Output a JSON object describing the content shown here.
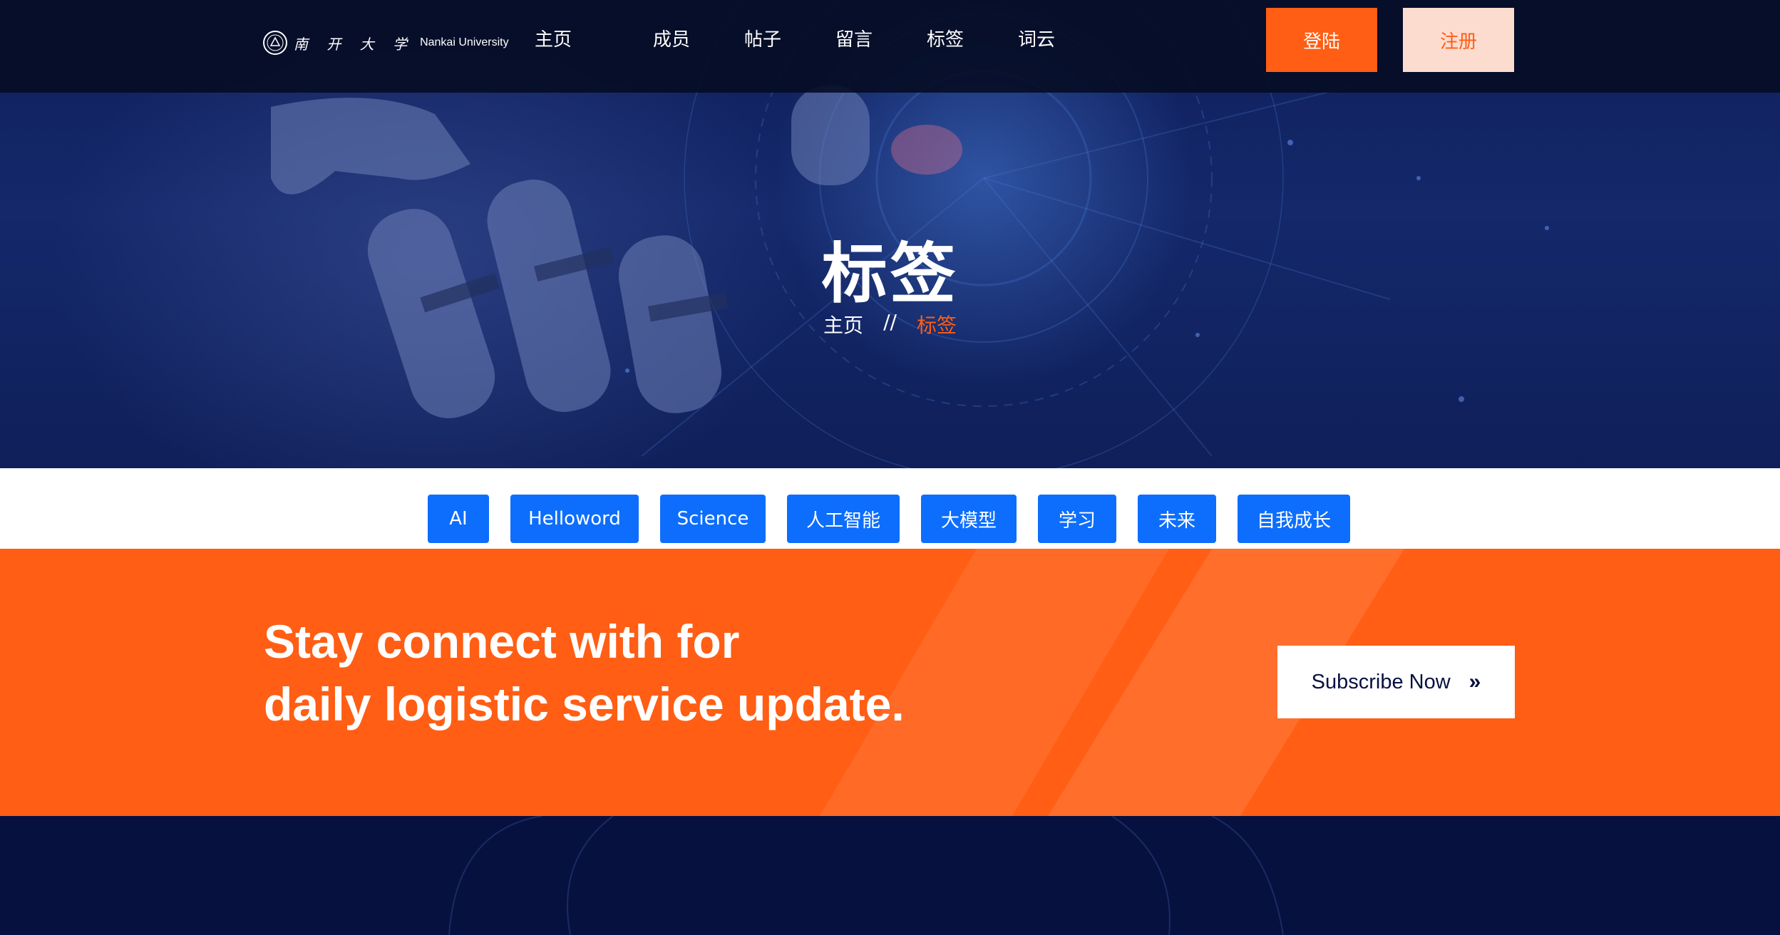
{
  "brand": {
    "name_cn": "南 开 大 学",
    "name_en": "Nankai University"
  },
  "nav": {
    "items": [
      {
        "label": "主页"
      },
      {
        "label": "成员"
      },
      {
        "label": "帖子"
      },
      {
        "label": "留言"
      },
      {
        "label": "标签"
      },
      {
        "label": "词云"
      }
    ],
    "login_label": "登陆",
    "register_label": "注册"
  },
  "hero": {
    "title": "标签",
    "breadcrumb": {
      "home": "主页",
      "separator": "//",
      "current": "标签"
    }
  },
  "tags": [
    {
      "label": "AI"
    },
    {
      "label": "Helloword"
    },
    {
      "label": "Science"
    },
    {
      "label": "人工智能"
    },
    {
      "label": "大模型"
    },
    {
      "label": "学习"
    },
    {
      "label": "未来"
    },
    {
      "label": "自我成长"
    }
  ],
  "newsletter": {
    "line1": "Stay connect with for",
    "line2": "daily logistic service update.",
    "button_label": "Subscribe Now",
    "button_icon": "double-chevron-right-icon"
  },
  "colors": {
    "accent": "#ff5e14",
    "tag_blue": "#0d6efd",
    "navy": "#071140",
    "register_bg": "#fddcd0"
  }
}
